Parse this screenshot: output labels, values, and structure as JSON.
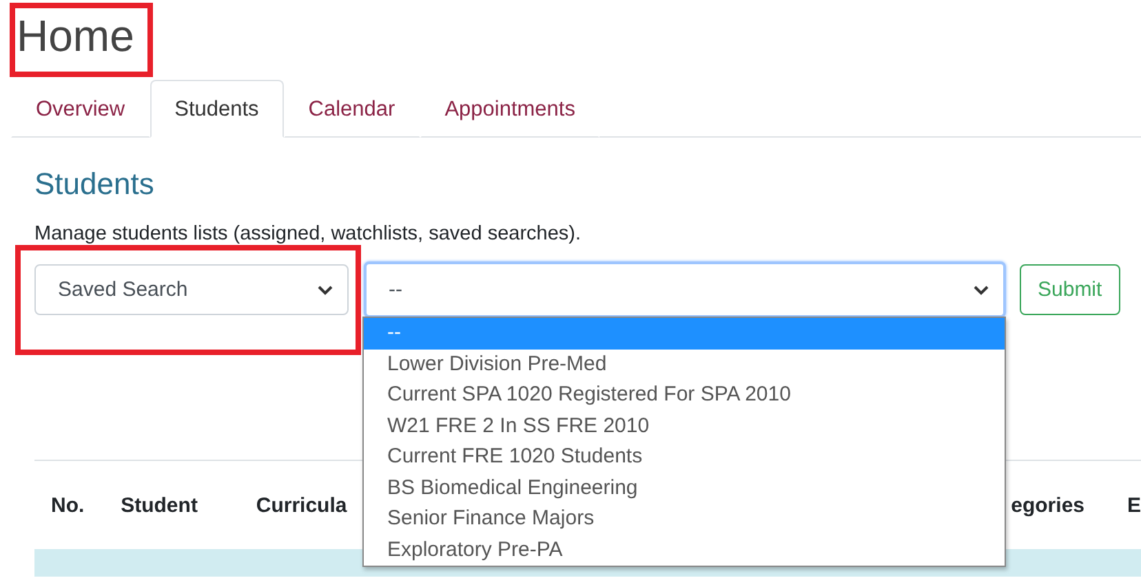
{
  "page_title": "Home",
  "tabs": [
    {
      "label": "Overview",
      "selected": false
    },
    {
      "label": "Students",
      "selected": true
    },
    {
      "label": "Calendar",
      "selected": false
    },
    {
      "label": "Appointments",
      "selected": false
    }
  ],
  "section": {
    "title": "Students",
    "description": "Manage students lists (assigned, watchlists, saved searches)."
  },
  "list_type_select": {
    "value": "Saved Search"
  },
  "list_select": {
    "value": "--",
    "open": true,
    "options": [
      {
        "label": "--",
        "selected": true
      },
      {
        "label": "Lower Division Pre-Med",
        "selected": false
      },
      {
        "label": "Current SPA 1020 Registered For SPA 2010",
        "selected": false
      },
      {
        "label": "W21 FRE 2 In SS FRE 2010",
        "selected": false
      },
      {
        "label": "Current FRE 1020 Students",
        "selected": false
      },
      {
        "label": "BS Biomedical Engineering",
        "selected": false
      },
      {
        "label": "Senior Finance Majors",
        "selected": false
      },
      {
        "label": "Exploratory Pre-PA",
        "selected": false
      }
    ]
  },
  "submit_button": "Submit",
  "table": {
    "columns": [
      "No.",
      "Student",
      "Curricula",
      "egories",
      "E"
    ]
  }
}
